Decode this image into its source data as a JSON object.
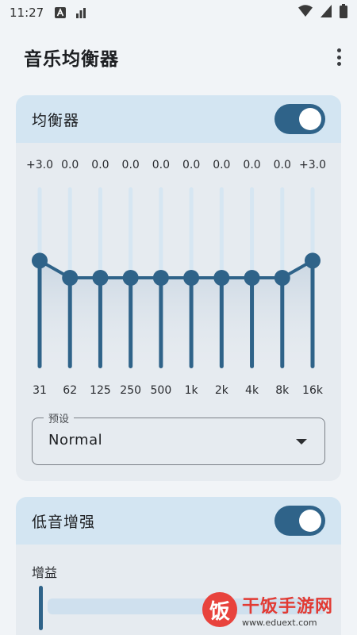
{
  "status_bar": {
    "time": "11:27",
    "icons": [
      "font-a-icon",
      "signal-bars-icon",
      "wifi-icon",
      "battery-icon"
    ]
  },
  "app_bar": {
    "title": "音乐均衡器",
    "menu_icon": "more-vert-icon"
  },
  "equalizer": {
    "title": "均衡器",
    "enabled": true,
    "bands": [
      {
        "freq": "31",
        "gain": 3.0,
        "gain_label": "+3.0"
      },
      {
        "freq": "62",
        "gain": 0.0,
        "gain_label": "0.0"
      },
      {
        "freq": "125",
        "gain": 0.0,
        "gain_label": "0.0"
      },
      {
        "freq": "250",
        "gain": 0.0,
        "gain_label": "0.0"
      },
      {
        "freq": "500",
        "gain": 0.0,
        "gain_label": "0.0"
      },
      {
        "freq": "1k",
        "gain": 0.0,
        "gain_label": "0.0"
      },
      {
        "freq": "2k",
        "gain": 0.0,
        "gain_label": "0.0"
      },
      {
        "freq": "4k",
        "gain": 0.0,
        "gain_label": "0.0"
      },
      {
        "freq": "8k",
        "gain": 0.0,
        "gain_label": "0.0"
      },
      {
        "freq": "16k",
        "gain": 3.0,
        "gain_label": "+3.0"
      }
    ],
    "preset": {
      "label": "预设",
      "value": "Normal"
    }
  },
  "bass_boost": {
    "title": "低音增强",
    "enabled": true,
    "gain_label": "增益",
    "gain_value": 0.0
  },
  "watermark": {
    "logo_char": "饭",
    "name": "干饭手游网",
    "url": "www.eduext.com"
  },
  "colors": {
    "accent": "#2f6389",
    "card_bg": "#e6ebf0",
    "header_bg": "#d3e5f2",
    "slider_track": "#d6e6f2",
    "background": "#f1f4f7"
  }
}
